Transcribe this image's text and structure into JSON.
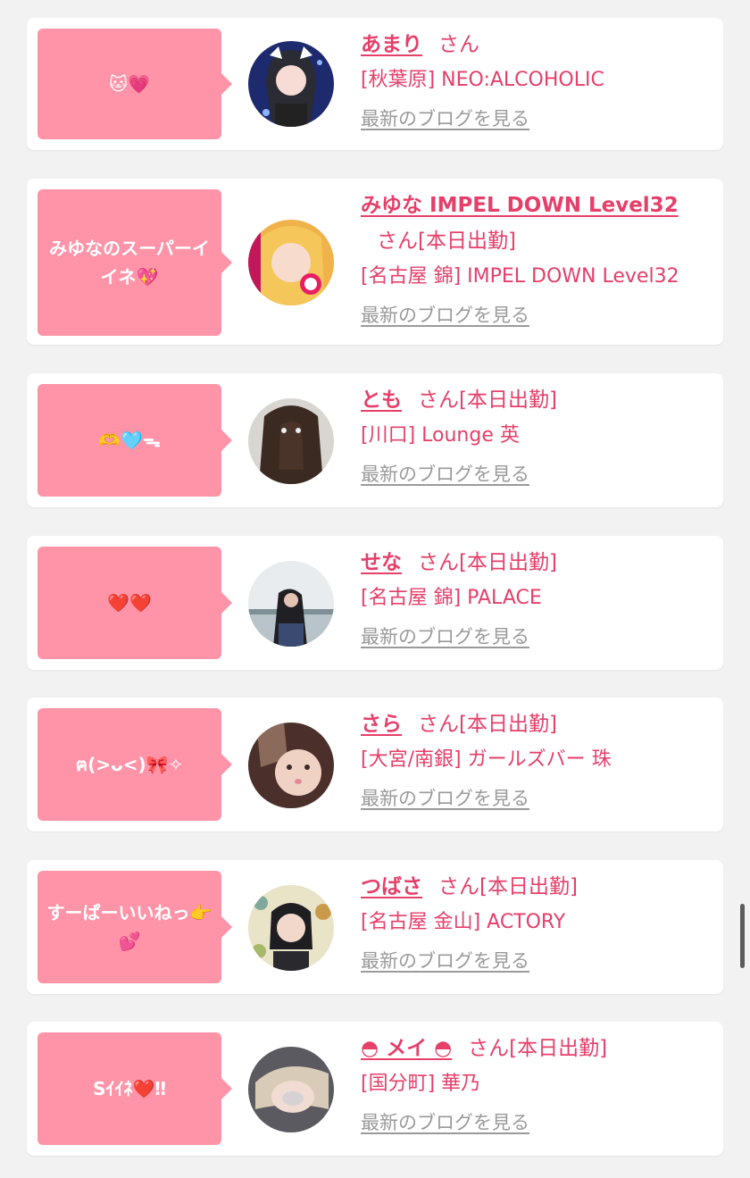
{
  "cards": [
    {
      "bubble": "🐱💗",
      "name": "あまり",
      "honorific": "さん",
      "status": "",
      "shop": "[秋葉原] NEO:ALCOHOLIC",
      "blog_link": "最新のブログを見る"
    },
    {
      "bubble": "みゆなのスーパーイイネ💖",
      "name": "みゆな IMPEL DOWN Level32",
      "honorific": "さん",
      "status": "[本日出勤]",
      "shop": "[名古屋 錦] IMPEL DOWN Level32",
      "blog_link": "最新のブログを見る"
    },
    {
      "bubble": "🫶🩵ᯓ",
      "name": "とも",
      "honorific": "さん",
      "status": "[本日出勤]",
      "shop": "[川口] Lounge 英",
      "blog_link": "最新のブログを見る"
    },
    {
      "bubble": "❤️❤️",
      "name": "せな",
      "honorific": "さん",
      "status": "[本日出勤]",
      "shop": "[名古屋 錦] PALACE",
      "blog_link": "最新のブログを見る"
    },
    {
      "bubble": "ฅ(>ᴗ<)🎀✧",
      "name": "さら",
      "honorific": "さん",
      "status": "[本日出勤]",
      "shop": "[大宮/南銀] ガールズバー 珠",
      "blog_link": "最新のブログを見る"
    },
    {
      "bubble": "すーぱーいいねっ👉💕",
      "name": "つばさ",
      "honorific": "さん",
      "status": "[本日出勤]",
      "shop": "[名古屋 金山] ACTORY",
      "blog_link": "最新のブログを見る"
    },
    {
      "bubble": "Sｲｲﾈ❤️‼",
      "name": "◓ メイ ◓",
      "honorific": "さん",
      "status": "[本日出勤]",
      "shop": "[国分町] 華乃",
      "blog_link": "最新のブログを見る"
    }
  ]
}
